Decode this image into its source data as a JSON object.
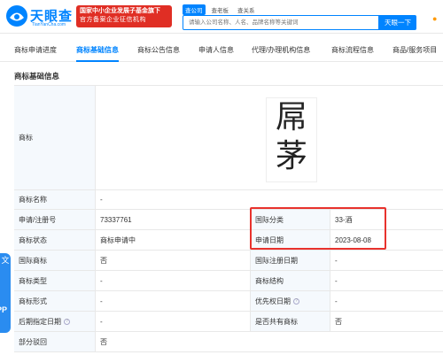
{
  "header": {
    "logo_text": "天眼查",
    "logo_domain": "TianYanCha.com",
    "badge_line1": "国家中小企业发展子基金旗下",
    "badge_line2": "官方备案企业征信机构",
    "search_tabs": [
      "查公司",
      "查老板",
      "查关系"
    ],
    "search_placeholder": "请输入公司名称、人名、品牌名称等关键词",
    "search_button": "天眼一下"
  },
  "tabs": [
    {
      "label": "商标申请进度",
      "active": false
    },
    {
      "label": "商标基础信息",
      "active": true
    },
    {
      "label": "商标公告信息",
      "active": false
    },
    {
      "label": "申请人信息",
      "active": false
    },
    {
      "label": "代理/办理机构信息",
      "active": false
    },
    {
      "label": "商标流程信息",
      "active": false
    },
    {
      "label": "商品/服务项目",
      "active": false
    }
  ],
  "section_title": "商标基础信息",
  "trademark": {
    "label": "商标",
    "glyphs": [
      "屌",
      "茅"
    ]
  },
  "rows": {
    "name": {
      "label": "商标名称",
      "value": "-"
    },
    "reg": {
      "label": "申请/注册号",
      "value": "73337761",
      "label2": "国际分类",
      "value2": "33-酒"
    },
    "status": {
      "label": "商标状态",
      "value": "商标申请中",
      "label2": "申请日期",
      "value2": "2023-08-08"
    },
    "intl": {
      "label": "国际商标",
      "value": "否",
      "label2": "国际注册日期",
      "value2": "-"
    },
    "type": {
      "label": "商标类型",
      "value": "-",
      "label2": "商标结构",
      "value2": "-"
    },
    "form": {
      "label": "商标形式",
      "value": "-",
      "label2": "优先权日期",
      "value2": "-"
    },
    "later": {
      "label": "后期指定日期",
      "value": "-",
      "label2": "是否共有商标",
      "value2": "否"
    },
    "partial": {
      "label": "部分驳回",
      "value": "否"
    }
  },
  "side": {
    "app_text": "PP"
  },
  "colors": {
    "brand": "#0084ff",
    "badge": "#e02e24",
    "highlight": "#e8322d",
    "label_bg": "#f5f9fd"
  }
}
